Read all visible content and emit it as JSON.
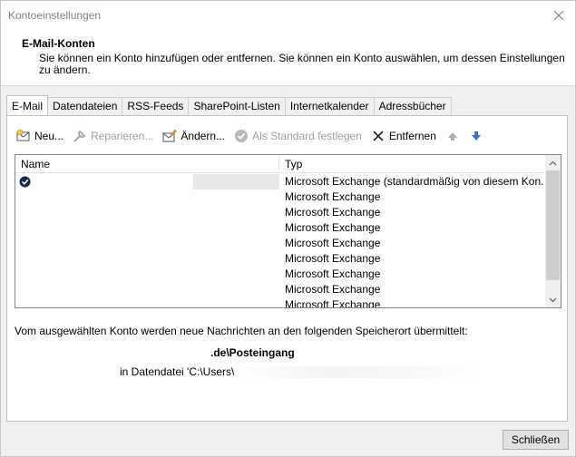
{
  "window": {
    "title": "Kontoeinstellungen"
  },
  "header": {
    "title": "E-Mail-Konten",
    "description": "Sie können ein Konto hinzufügen oder entfernen. Sie können ein Konto auswählen, um dessen Einstellungen zu ändern."
  },
  "tabs": [
    {
      "label": "E-Mail",
      "active": true
    },
    {
      "label": "Datendateien"
    },
    {
      "label": "RSS-Feeds"
    },
    {
      "label": "SharePoint-Listen"
    },
    {
      "label": "Internetkalender"
    },
    {
      "label": "Adressbücher"
    }
  ],
  "toolbar": {
    "new_label": "Neu...",
    "repair_label": "Reparieren...",
    "change_label": "Ändern...",
    "default_label": "Als Standard festlegen",
    "remove_label": "Entfernen",
    "move_up_icon": "arrow-up-icon",
    "move_down_icon": "arrow-down-icon"
  },
  "list": {
    "columns": {
      "name": "Name",
      "type": "Typ"
    },
    "rows": [
      {
        "name": "",
        "type": "Microsoft Exchange (standardmäßig von diesem Kon...",
        "default": true
      },
      {
        "name": "",
        "type": "Microsoft Exchange"
      },
      {
        "name": "",
        "type": "Microsoft Exchange"
      },
      {
        "name": "",
        "type": "Microsoft Exchange"
      },
      {
        "name": "",
        "type": "Microsoft Exchange"
      },
      {
        "name": "",
        "type": "Microsoft Exchange"
      },
      {
        "name": "",
        "type": "Microsoft Exchange"
      },
      {
        "name": "",
        "type": "Microsoft Exchange"
      },
      {
        "name": "",
        "type": "Microsoft Exchange"
      }
    ]
  },
  "delivery": {
    "info": "Vom ausgewählten Konto werden neue Nachrichten an den folgenden Speicherort übermittelt:",
    "folder": ".de\\Posteingang",
    "datafile_prefix": "in Datendatei 'C:\\Users\\"
  },
  "footer": {
    "close_label": "Schließen"
  },
  "colors": {
    "accent_blue": "#2b5797",
    "disabled": "#a0a0a0",
    "selection": "#e8e8e8"
  }
}
